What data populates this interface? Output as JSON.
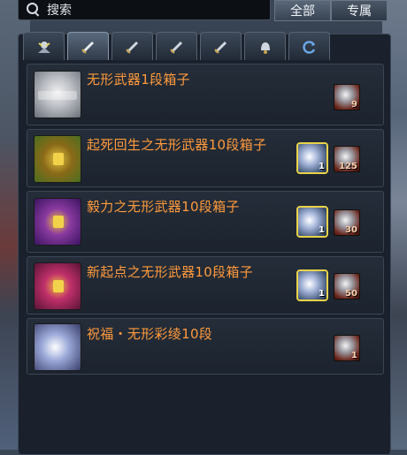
{
  "search": {
    "placeholder": "搜索",
    "filters": [
      {
        "label": "全部",
        "selected": true
      },
      {
        "label": "专属",
        "selected": false
      }
    ]
  },
  "tabs": [
    {
      "icon": "fairy-icon",
      "selected": false
    },
    {
      "icon": "sword-icon",
      "selected": true
    },
    {
      "icon": "sword-icon",
      "selected": false
    },
    {
      "icon": "sword-icon",
      "selected": false
    },
    {
      "icon": "sword-icon",
      "selected": false
    },
    {
      "icon": "bell-icon",
      "selected": false
    },
    {
      "icon": "refresh-icon",
      "selected": false
    }
  ],
  "items": [
    {
      "name": "无形武器1段箱子",
      "icon": "silver-chest-icon",
      "cost_qty": "9",
      "material_qty": ""
    },
    {
      "name": "起死回生之无形武器10段箱子",
      "icon": "green-chest-icon",
      "cost_qty": "125",
      "material_qty": "1"
    },
    {
      "name": "毅力之无形武器10段箱子",
      "icon": "purple-chest-icon",
      "cost_qty": "30",
      "material_qty": "1"
    },
    {
      "name": "新起点之无形武器10段箱子",
      "icon": "red-chest-icon",
      "cost_qty": "50",
      "material_qty": "1"
    },
    {
      "name": "祝福・无形彩绫10段",
      "icon": "ribbon-icon",
      "cost_qty": "1",
      "material_qty": ""
    }
  ],
  "colors": {
    "item_name": "#ff9a3c",
    "material_border": "#e8d24a",
    "panel_bg": "#1a212c"
  }
}
